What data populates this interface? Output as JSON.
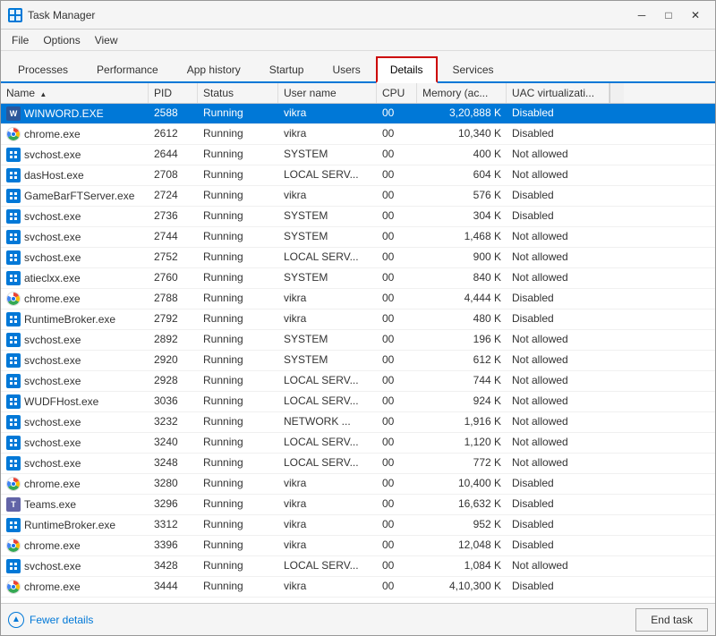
{
  "window": {
    "title": "Task Manager",
    "icon": "TM"
  },
  "menu": {
    "items": [
      "File",
      "Options",
      "View"
    ]
  },
  "tabs": [
    {
      "label": "Processes",
      "active": false
    },
    {
      "label": "Performance",
      "active": false
    },
    {
      "label": "App history",
      "active": false
    },
    {
      "label": "Startup",
      "active": false
    },
    {
      "label": "Users",
      "active": false
    },
    {
      "label": "Details",
      "active": true
    },
    {
      "label": "Services",
      "active": false
    }
  ],
  "columns": [
    {
      "label": "Name",
      "sort": "asc"
    },
    {
      "label": "PID",
      "sort": null
    },
    {
      "label": "Status",
      "sort": null
    },
    {
      "label": "User name",
      "sort": null
    },
    {
      "label": "CPU",
      "sort": null
    },
    {
      "label": "Memory (ac...",
      "sort": null
    },
    {
      "label": "UAC virtualizati...",
      "sort": null
    }
  ],
  "rows": [
    {
      "name": "WINWORD.EXE",
      "pid": "2588",
      "status": "Running",
      "user": "vikra",
      "cpu": "00",
      "memory": "3,20,888 K",
      "uac": "Disabled",
      "selected": true,
      "iconType": "word"
    },
    {
      "name": "chrome.exe",
      "pid": "2612",
      "status": "Running",
      "user": "vikra",
      "cpu": "00",
      "memory": "10,340 K",
      "uac": "Disabled",
      "selected": false,
      "iconType": "chrome"
    },
    {
      "name": "svchost.exe",
      "pid": "2644",
      "status": "Running",
      "user": "SYSTEM",
      "cpu": "00",
      "memory": "400 K",
      "uac": "Not allowed",
      "selected": false,
      "iconType": "system"
    },
    {
      "name": "dasHost.exe",
      "pid": "2708",
      "status": "Running",
      "user": "LOCAL SERV...",
      "cpu": "00",
      "memory": "604 K",
      "uac": "Not allowed",
      "selected": false,
      "iconType": "system"
    },
    {
      "name": "GameBarFTServer.exe",
      "pid": "2724",
      "status": "Running",
      "user": "vikra",
      "cpu": "00",
      "memory": "576 K",
      "uac": "Disabled",
      "selected": false,
      "iconType": "system"
    },
    {
      "name": "svchost.exe",
      "pid": "2736",
      "status": "Running",
      "user": "SYSTEM",
      "cpu": "00",
      "memory": "304 K",
      "uac": "Disabled",
      "selected": false,
      "iconType": "system"
    },
    {
      "name": "svchost.exe",
      "pid": "2744",
      "status": "Running",
      "user": "SYSTEM",
      "cpu": "00",
      "memory": "1,468 K",
      "uac": "Not allowed",
      "selected": false,
      "iconType": "system"
    },
    {
      "name": "svchost.exe",
      "pid": "2752",
      "status": "Running",
      "user": "LOCAL SERV...",
      "cpu": "00",
      "memory": "900 K",
      "uac": "Not allowed",
      "selected": false,
      "iconType": "system"
    },
    {
      "name": "atieclxx.exe",
      "pid": "2760",
      "status": "Running",
      "user": "SYSTEM",
      "cpu": "00",
      "memory": "840 K",
      "uac": "Not allowed",
      "selected": false,
      "iconType": "generic"
    },
    {
      "name": "chrome.exe",
      "pid": "2788",
      "status": "Running",
      "user": "vikra",
      "cpu": "00",
      "memory": "4,444 K",
      "uac": "Disabled",
      "selected": false,
      "iconType": "chrome"
    },
    {
      "name": "RuntimeBroker.exe",
      "pid": "2792",
      "status": "Running",
      "user": "vikra",
      "cpu": "00",
      "memory": "480 K",
      "uac": "Disabled",
      "selected": false,
      "iconType": "system"
    },
    {
      "name": "svchost.exe",
      "pid": "2892",
      "status": "Running",
      "user": "SYSTEM",
      "cpu": "00",
      "memory": "196 K",
      "uac": "Not allowed",
      "selected": false,
      "iconType": "system"
    },
    {
      "name": "svchost.exe",
      "pid": "2920",
      "status": "Running",
      "user": "SYSTEM",
      "cpu": "00",
      "memory": "612 K",
      "uac": "Not allowed",
      "selected": false,
      "iconType": "system"
    },
    {
      "name": "svchost.exe",
      "pid": "2928",
      "status": "Running",
      "user": "LOCAL SERV...",
      "cpu": "00",
      "memory": "744 K",
      "uac": "Not allowed",
      "selected": false,
      "iconType": "system"
    },
    {
      "name": "WUDFHost.exe",
      "pid": "3036",
      "status": "Running",
      "user": "LOCAL SERV...",
      "cpu": "00",
      "memory": "924 K",
      "uac": "Not allowed",
      "selected": false,
      "iconType": "system"
    },
    {
      "name": "svchost.exe",
      "pid": "3232",
      "status": "Running",
      "user": "NETWORK ...",
      "cpu": "00",
      "memory": "1,916 K",
      "uac": "Not allowed",
      "selected": false,
      "iconType": "system"
    },
    {
      "name": "svchost.exe",
      "pid": "3240",
      "status": "Running",
      "user": "LOCAL SERV...",
      "cpu": "00",
      "memory": "1,120 K",
      "uac": "Not allowed",
      "selected": false,
      "iconType": "system"
    },
    {
      "name": "svchost.exe",
      "pid": "3248",
      "status": "Running",
      "user": "LOCAL SERV...",
      "cpu": "00",
      "memory": "772 K",
      "uac": "Not allowed",
      "selected": false,
      "iconType": "system"
    },
    {
      "name": "chrome.exe",
      "pid": "3280",
      "status": "Running",
      "user": "vikra",
      "cpu": "00",
      "memory": "10,400 K",
      "uac": "Disabled",
      "selected": false,
      "iconType": "chrome"
    },
    {
      "name": "Teams.exe",
      "pid": "3296",
      "status": "Running",
      "user": "vikra",
      "cpu": "00",
      "memory": "16,632 K",
      "uac": "Disabled",
      "selected": false,
      "iconType": "teams"
    },
    {
      "name": "RuntimeBroker.exe",
      "pid": "3312",
      "status": "Running",
      "user": "vikra",
      "cpu": "00",
      "memory": "952 K",
      "uac": "Disabled",
      "selected": false,
      "iconType": "system"
    },
    {
      "name": "chrome.exe",
      "pid": "3396",
      "status": "Running",
      "user": "vikra",
      "cpu": "00",
      "memory": "12,048 K",
      "uac": "Disabled",
      "selected": false,
      "iconType": "chrome"
    },
    {
      "name": "svchost.exe",
      "pid": "3428",
      "status": "Running",
      "user": "LOCAL SERV...",
      "cpu": "00",
      "memory": "1,084 K",
      "uac": "Not allowed",
      "selected": false,
      "iconType": "system"
    },
    {
      "name": "chrome.exe",
      "pid": "3444",
      "status": "Running",
      "user": "vikra",
      "cpu": "00",
      "memory": "4,10,300 K",
      "uac": "Disabled",
      "selected": false,
      "iconType": "chrome"
    }
  ],
  "status_bar": {
    "fewer_details_label": "Fewer details",
    "end_task_label": "End task"
  },
  "window_controls": {
    "minimize": "─",
    "maximize": "□",
    "close": "✕"
  }
}
